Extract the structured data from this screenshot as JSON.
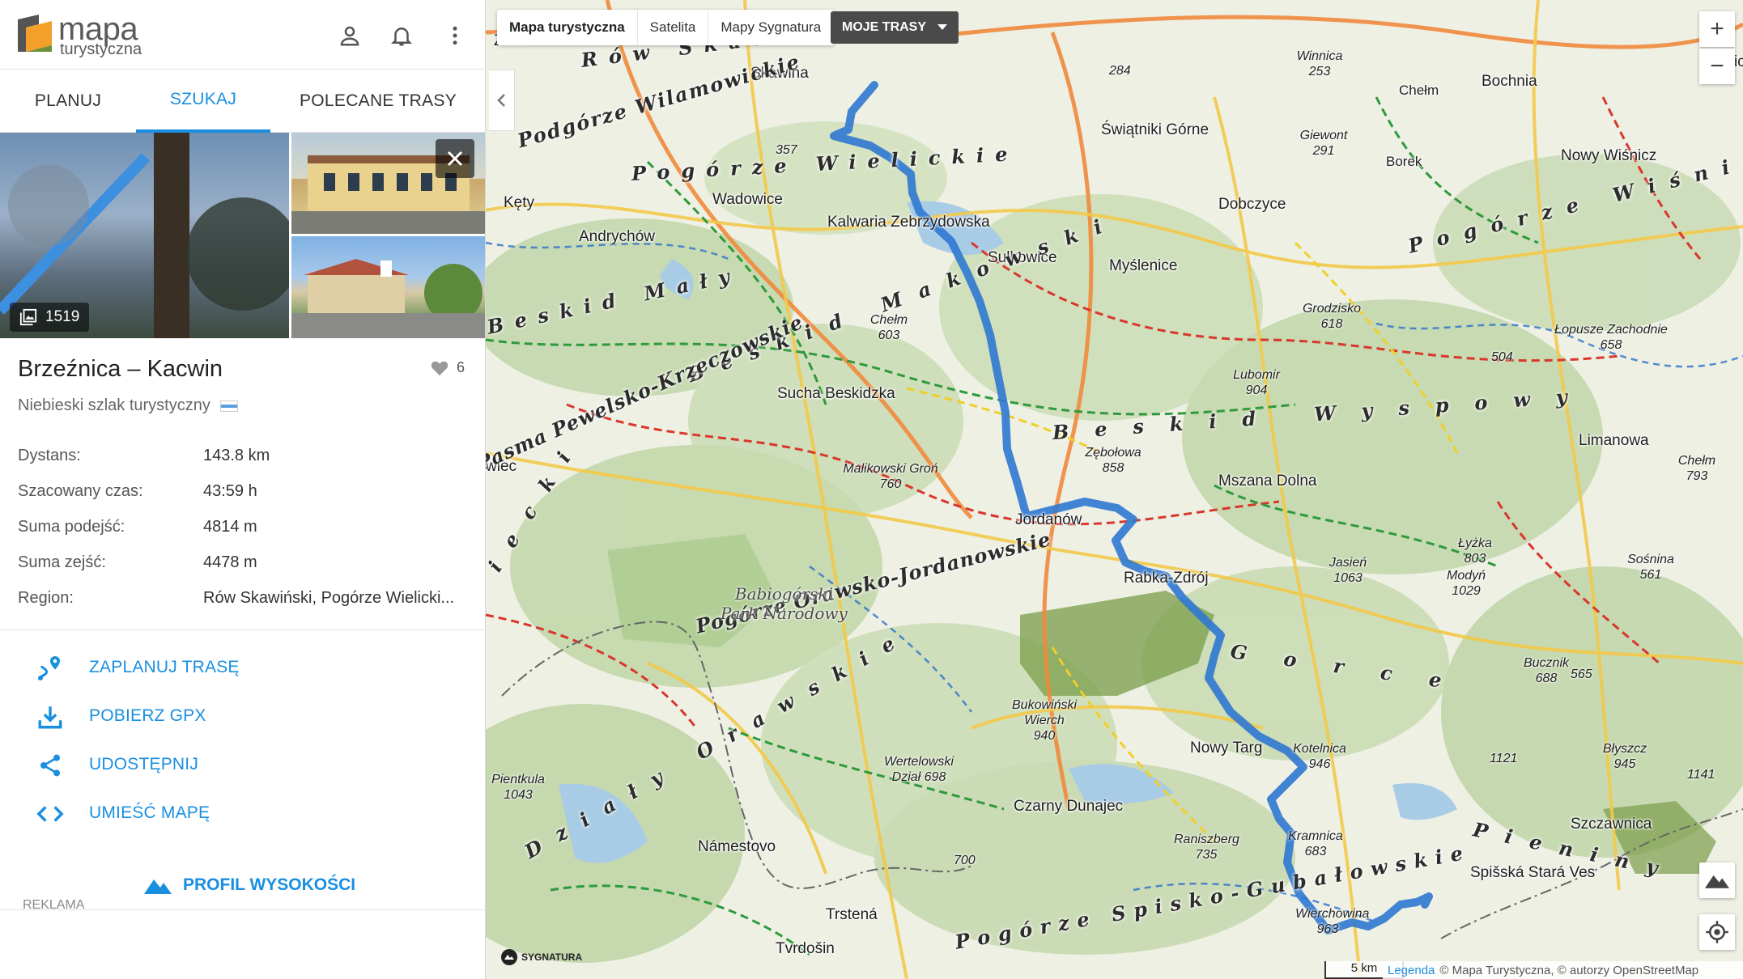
{
  "brand": {
    "line1": "mapa",
    "line2": "turystyczna"
  },
  "tabs": [
    "PLANUJ",
    "SZUKAJ",
    "POLECANE TRASY"
  ],
  "photos": {
    "count": "1519"
  },
  "route": {
    "title": "Brzeźnica – Kacwin",
    "likes": "6",
    "type": "Niebieski szlak turystyczny",
    "stats": [
      {
        "label": "Dystans:",
        "value": "143.8 km"
      },
      {
        "label": "Szacowany czas:",
        "value": "43:59 h"
      },
      {
        "label": "Suma podejść:",
        "value": "4814 m"
      },
      {
        "label": "Suma zejść:",
        "value": "4478 m"
      },
      {
        "label": "Region:",
        "value": "Rów Skawiński, Pogórze Wielicki..."
      }
    ]
  },
  "actions": [
    "ZAPLANUJ TRASĘ",
    "POBIERZ GPX",
    "UDOSTĘPNIJ",
    "UMIEŚĆ MAPĘ"
  ],
  "profile_button": "PROFIL WYSOKOŚCI",
  "ad_label": "REKLAMA",
  "map": {
    "layers": [
      "Mapa turystyczna",
      "Satelita",
      "Mapy Sygnatura"
    ],
    "active_layer": "Mapa turystyczna",
    "my_routes": "MOJE TRASY",
    "zoom_in": "+",
    "zoom_out": "−",
    "scale": "5 km",
    "attribution_link": "Legenda",
    "attribution": "© Mapa Turystyczna, © autorzy OpenStreetMap",
    "sygnatura": "SYGNATURA",
    "route_color": "#2f78d2",
    "towns": [
      "Zator",
      "Skawina",
      "Wieliczka",
      "Bochnia",
      "Chełm",
      "Kęty",
      "Wadowice",
      "Andrychów",
      "Kalwaria Zebrzydowska",
      "Świątniki Górne",
      "Dobczyce",
      "Sułkowice",
      "Myślenice",
      "Nowy Wiśnicz",
      "Borek",
      "Sucha Beskidzka",
      "Jordanów",
      "Mszana Dolna",
      "Limanowa",
      "Rabka-Zdrój",
      "Nowy Targ",
      "Czarny Dunajec",
      "Námestovo",
      "Trstená",
      "Tvrdošin",
      "Szczawnica",
      "Spišská Stará Ves",
      "wiec"
    ],
    "peaks": [
      "357",
      "284",
      "Winnica 253",
      "Giewont 291",
      "Grodzisko 618",
      "Chełm 603",
      "Łopusze Zachodnie 658",
      "504",
      "Lubomir 904",
      "Zębołowa 858",
      "Malikowski Groń 760",
      "Jasień 1063",
      "Łyżka 803",
      "Modyń 1029",
      "Chełm 793",
      "Sośnina 561",
      "Bucznik 688",
      "565",
      "Kotelnica 946",
      "Bukowiński Wierch 940",
      "Wertelowski Dział 698",
      "1121",
      "Błyszcz 945",
      "1141",
      "Raniszberg 735",
      "Kramnica 683",
      "700",
      "Wierchowina 963",
      "Pientkula 1043"
    ],
    "regions": [
      "Rów Skawiński",
      "Pogórze Wielickie",
      "Podgórze Wilamowickie",
      "Beskid Mały",
      "Beskid Makowski",
      "Beskid Wyspowy",
      "Pasma Pewelsko-Krzeczowskie",
      "Pogórze Orawsko-Jordanowskie",
      "Gorce",
      "Żywiecki",
      "Działy Orawskie",
      "Pieniny",
      "Pogórze Spisko-Gubałowskie",
      "Pogórze Wiśnickie"
    ],
    "park": [
      "Babiogórski",
      "Park Narodowy"
    ]
  }
}
